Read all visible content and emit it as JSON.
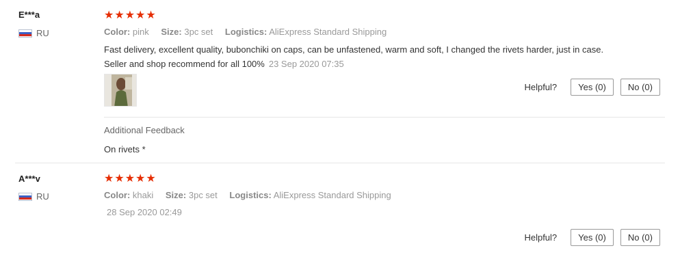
{
  "reviews": [
    {
      "user": "E***a",
      "country": "RU",
      "rating": 5,
      "attributes": {
        "color_label": "Color:",
        "color": "pink",
        "size_label": "Size:",
        "size": "3pc set",
        "logistics_label": "Logistics:",
        "logistics": "AliExpress Standard Shipping"
      },
      "text": "Fast delivery, excellent quality, bubonchiki on caps, can be unfastened, warm and soft, I changed the rivets harder, just in case. Seller and shop recommend for all 100%",
      "date": "23 Sep 2020 07:35",
      "helpful_label": "Helpful?",
      "yes_label": "Yes (0)",
      "no_label": "No (0)",
      "additional_feedback_title": "Additional Feedback",
      "additional_feedback_text": "On rivets *"
    },
    {
      "user": "A***v",
      "country": "RU",
      "rating": 5,
      "attributes": {
        "color_label": "Color:",
        "color": "khaki",
        "size_label": "Size:",
        "size": "3pc set",
        "logistics_label": "Logistics:",
        "logistics": "AliExpress Standard Shipping"
      },
      "date": "28 Sep 2020 02:49",
      "helpful_label": "Helpful?",
      "yes_label": "Yes (0)",
      "no_label": "No (0)"
    }
  ],
  "colors": {
    "star": "#e62e04",
    "divider": "#e6e6e6"
  },
  "icons": {
    "flag": "russia-flag-icon",
    "star": "star-icon",
    "photo": "review-photo"
  }
}
